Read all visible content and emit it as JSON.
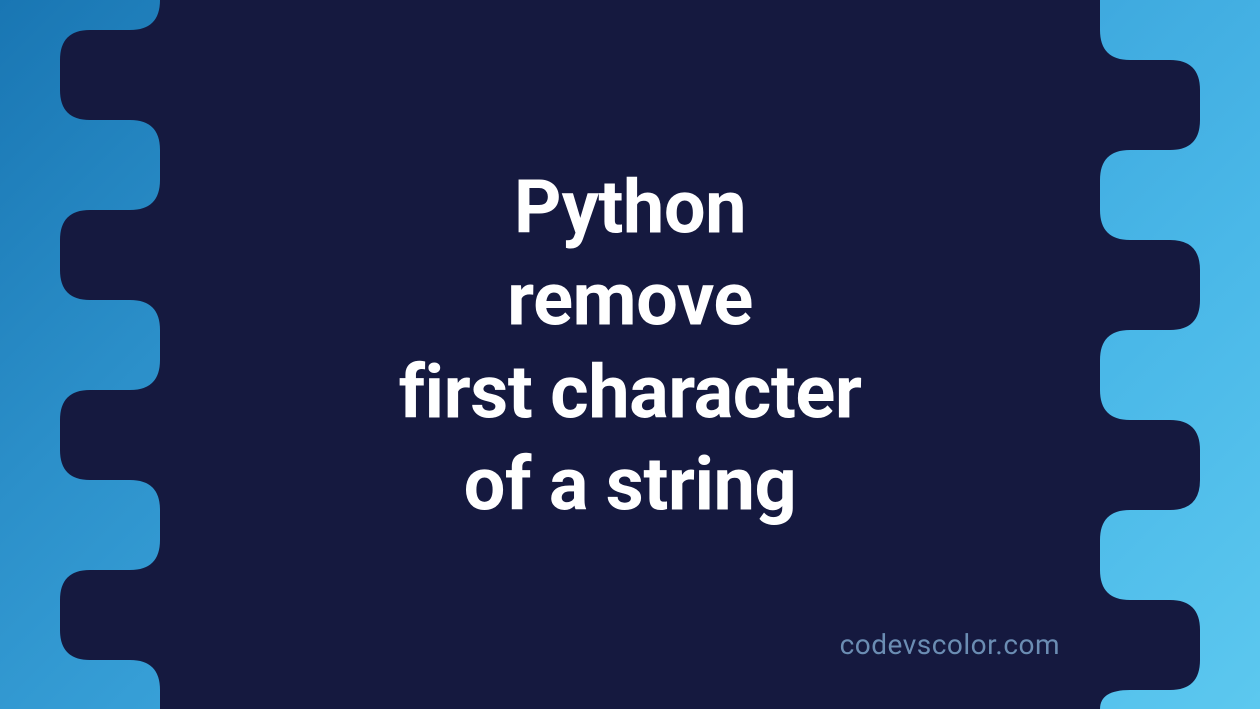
{
  "title": {
    "line1": "Python",
    "line2": "remove",
    "line3": "first character",
    "line4": "of a string"
  },
  "watermark": "codevscolor.com",
  "colors": {
    "blob": "#15193f",
    "text": "#ffffff",
    "watermark": "#6b8db3",
    "gradient_start": "#1976b3",
    "gradient_end": "#5cc8ef"
  }
}
